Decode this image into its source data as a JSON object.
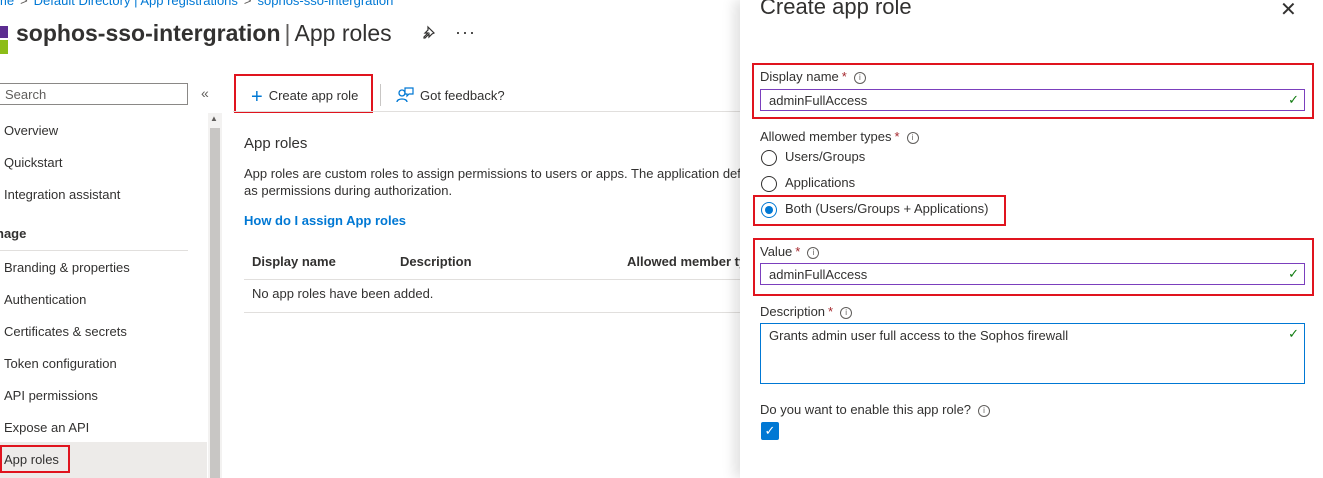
{
  "breadcrumb": {
    "item1": "me",
    "item2": "Default Directory | App registrations",
    "item3": "sophos-sso-intergration",
    "separator": ">"
  },
  "page_title": {
    "app_name": "sophos-sso-intergration",
    "separator": "|",
    "section": "App roles"
  },
  "sidebar": {
    "search_placeholder": "Search",
    "collapse_glyph": "«",
    "items": [
      "Overview",
      "Quickstart",
      "Integration assistant"
    ],
    "section_label": "nage",
    "manage_items": [
      "Branding & properties",
      "Authentication",
      "Certificates & secrets",
      "Token configuration",
      "API permissions",
      "Expose an API",
      "App roles"
    ],
    "selected": "App roles"
  },
  "toolbar": {
    "create_label": "Create app role",
    "feedback_label": "Got feedback?"
  },
  "main": {
    "section_title": "App roles",
    "description_line1": "App roles are custom roles to assign permissions to users or apps. The application defi",
    "description_line2": "as permissions during authorization.",
    "help_link": "How do I assign App roles",
    "columns": [
      "Display name",
      "Description",
      "Allowed member ty"
    ],
    "empty_text": "No app roles have been added."
  },
  "panel": {
    "title": "Create app role",
    "display_name": {
      "label": "Display name",
      "value": "adminFullAccess"
    },
    "member_types": {
      "label": "Allowed member types",
      "options": [
        "Users/Groups",
        "Applications",
        "Both (Users/Groups + Applications)"
      ],
      "selected": "Both (Users/Groups + Applications)"
    },
    "value_field": {
      "label": "Value",
      "value": "adminFullAccess"
    },
    "description": {
      "label": "Description",
      "value": "Grants admin user full access to the Sophos firewall"
    },
    "enable": {
      "label": "Do you want to enable this app role?",
      "checked": true
    },
    "required_mark": "*",
    "info_glyph": "i"
  },
  "colors": {
    "accent": "#0078d4",
    "highlight": "#e0141e",
    "valid": "#107c10",
    "required": "#a4262c"
  },
  "icons": [
    "app-icon",
    "pin-icon",
    "more-icon",
    "plus-icon",
    "feedback-icon",
    "close-icon",
    "info-icon",
    "checkmark-icon"
  ]
}
